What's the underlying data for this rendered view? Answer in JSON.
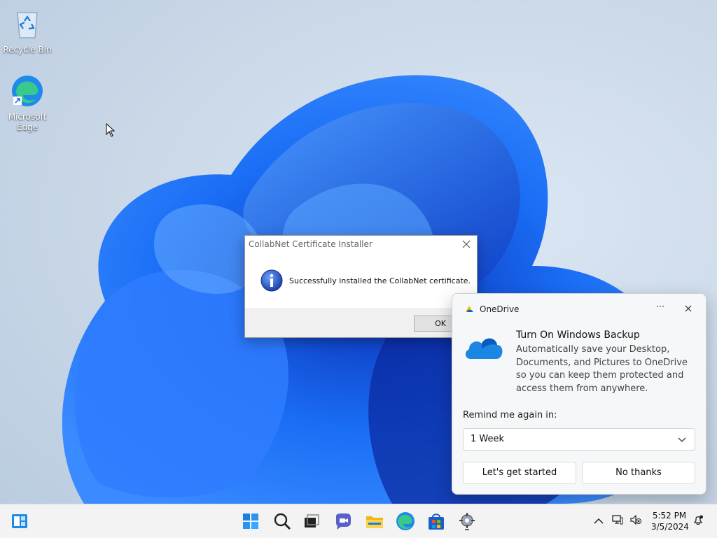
{
  "desktop": {
    "icons": [
      {
        "label": "Recycle Bin",
        "icon": "recycle-bin-icon"
      },
      {
        "label": "Microsoft\nEdge",
        "icon": "edge-icon"
      }
    ]
  },
  "dialog": {
    "title": "CollabNet Certificate Installer",
    "message": "Successfully installed the CollabNet certificate.",
    "ok_label": "OK",
    "icon": "info-icon"
  },
  "toast": {
    "app_name": "OneDrive",
    "more_label": "···",
    "heading": "Turn On Windows Backup",
    "description": "Automatically save your Desktop, Documents, and Pictures to OneDrive so you can keep them protected and access them from anywhere.",
    "remind_label": "Remind me again in:",
    "remind_value": "1 Week",
    "primary_button": "Let's get started",
    "secondary_button": "No thanks"
  },
  "taskbar": {
    "apps": [
      "widgets-icon",
      "start-icon",
      "search-icon",
      "task-view-icon",
      "chat-icon",
      "file-explorer-icon",
      "edge-icon",
      "store-icon",
      "installer-icon"
    ],
    "tray": {
      "time": "5:52 PM",
      "date": "3/5/2024"
    }
  },
  "colors": {
    "accent": "#0067c0",
    "wallpaper_bloom": "#1a6ef5"
  }
}
